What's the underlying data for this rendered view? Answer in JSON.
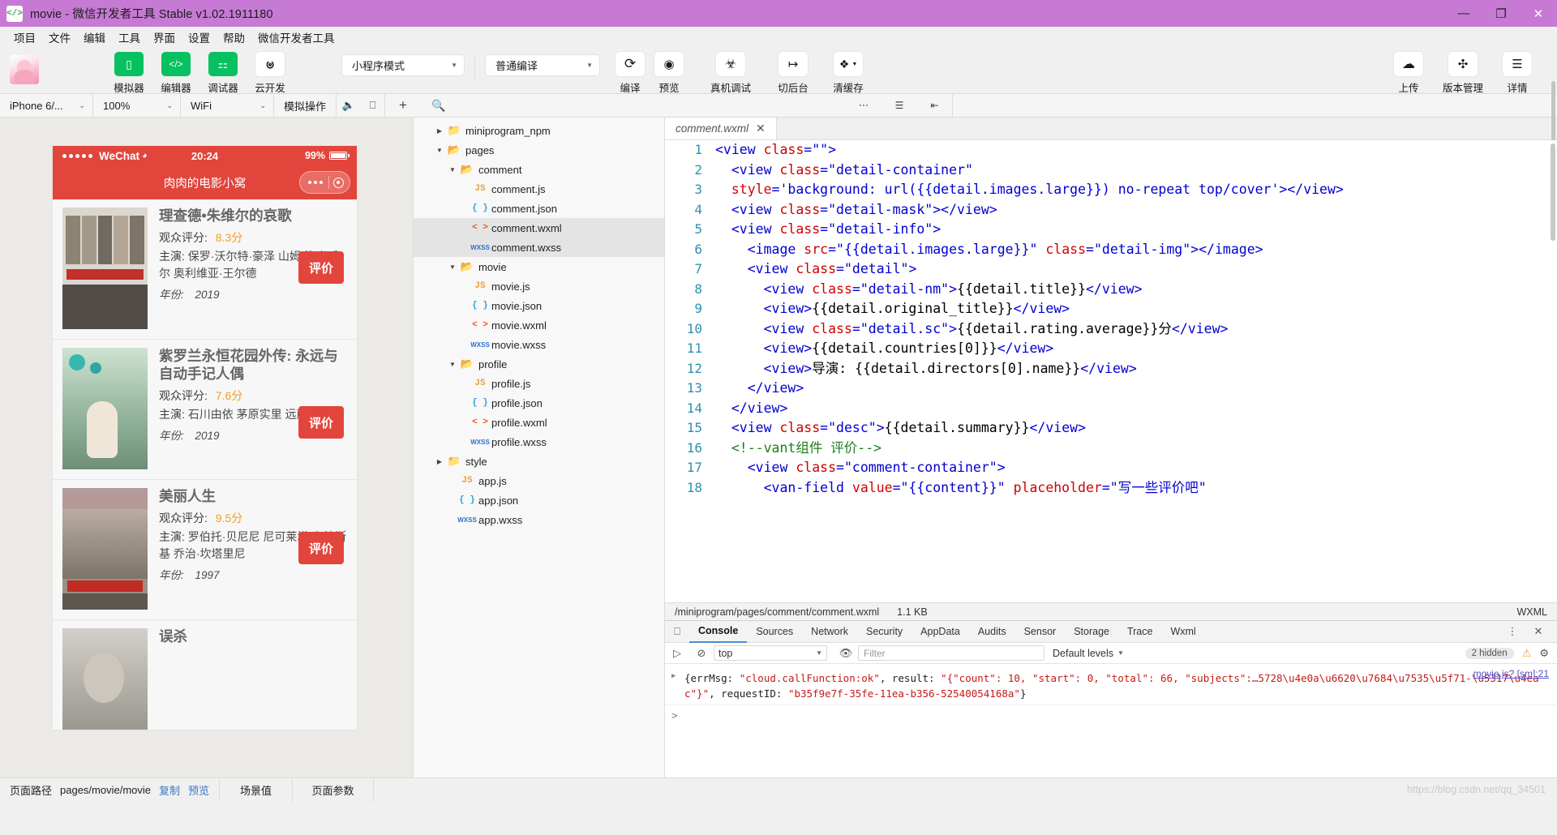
{
  "titlebar": {
    "title": "movie - 微信开发者工具 Stable v1.02.1911180",
    "logo": "</>",
    "minimize": "—",
    "maximize": "❐",
    "close": "✕"
  },
  "menubar": {
    "items": [
      "项目",
      "文件",
      "编辑",
      "工具",
      "界面",
      "设置",
      "帮助",
      "微信开发者工具"
    ]
  },
  "toolbar": {
    "left_tools": [
      {
        "label": "模拟器",
        "icon": "phone-icon",
        "glyph": "▯",
        "style": "green"
      },
      {
        "label": "编辑器",
        "icon": "code-icon",
        "glyph": "</>",
        "style": "green"
      },
      {
        "label": "调试器",
        "icon": "sliders-icon",
        "glyph": "⚏",
        "style": "green"
      },
      {
        "label": "云开发",
        "icon": "cloud-dev-icon",
        "glyph": "ᛩ",
        "style": "white"
      }
    ],
    "mode_select": "小程序模式",
    "compile_select": "普通编译",
    "actions": [
      {
        "label": "编译",
        "icon": "refresh-icon",
        "glyph": "⟳"
      },
      {
        "label": "预览",
        "icon": "eye-icon",
        "glyph": "◉"
      },
      {
        "label": "真机调试",
        "icon": "bug-icon",
        "glyph": "🐞"
      },
      {
        "label": "切后台",
        "icon": "background-icon",
        "glyph": "↦"
      },
      {
        "label": "清缓存",
        "icon": "layers-icon",
        "glyph": "≋"
      }
    ],
    "right_actions": [
      {
        "label": "上传",
        "icon": "upload-cloud-icon",
        "glyph": "☁"
      },
      {
        "label": "版本管理",
        "icon": "branch-icon",
        "glyph": "ᛤ"
      },
      {
        "label": "详情",
        "icon": "menu-icon",
        "glyph": "☰"
      }
    ]
  },
  "devicebar": {
    "device": "iPhone 6/...",
    "zoom": "100%",
    "network": "WiFi",
    "simulate": "模拟操作",
    "icons": [
      "volume-icon",
      "window-icon"
    ]
  },
  "simulator": {
    "status": {
      "carrier": "WeChat",
      "time": "20:24",
      "battery": "99%"
    },
    "nav_title": "肉肉的电影小窝",
    "labels": {
      "rating": "观众评分:",
      "actors": "主演:",
      "year": "年份:",
      "button": "评价"
    },
    "movies": [
      {
        "title": "理查德•朱维尔的哀歌",
        "rating": "8.3分",
        "actors": "保罗·沃尔特·豪泽 山姆·洛克威尔 奥利维亚·王尔德",
        "year": "2019",
        "poster": "p1"
      },
      {
        "title": "紫罗兰永恒花园外传: 永远与自动手记人偶",
        "rating": "7.6分",
        "actors": "石川由依 茅原实里 远藤绫",
        "year": "2019",
        "poster": "p2"
      },
      {
        "title": "美丽人生",
        "rating": "9.5分",
        "actors": "罗伯托·贝尼尼 尼可莱塔·布拉斯基 乔治·坎塔里尼",
        "year": "1997",
        "poster": "p3"
      },
      {
        "title": "误杀",
        "rating": "",
        "actors": "",
        "year": "",
        "poster": "p4"
      }
    ]
  },
  "explorer": {
    "toolbar_icons": [
      "add-icon",
      "search-icon",
      "more-icon",
      "collapse-icon",
      "sidebar-toggle-icon"
    ],
    "tree": [
      {
        "label": "miniprogram_npm",
        "type": "folder",
        "depth": 1,
        "expanded": false,
        "selected": false
      },
      {
        "label": "pages",
        "type": "folder",
        "depth": 1,
        "expanded": true,
        "selected": false
      },
      {
        "label": "comment",
        "type": "folder",
        "depth": 2,
        "expanded": true,
        "selected": false
      },
      {
        "label": "comment.js",
        "type": "js",
        "depth": 3,
        "selected": false
      },
      {
        "label": "comment.json",
        "type": "json",
        "depth": 3,
        "selected": false
      },
      {
        "label": "comment.wxml",
        "type": "wxml",
        "depth": 3,
        "selected": true
      },
      {
        "label": "comment.wxss",
        "type": "wxss",
        "depth": 3,
        "selected": true
      },
      {
        "label": "movie",
        "type": "folder",
        "depth": 2,
        "expanded": true,
        "selected": false
      },
      {
        "label": "movie.js",
        "type": "js",
        "depth": 3,
        "selected": false
      },
      {
        "label": "movie.json",
        "type": "json",
        "depth": 3,
        "selected": false
      },
      {
        "label": "movie.wxml",
        "type": "wxml",
        "depth": 3,
        "selected": false
      },
      {
        "label": "movie.wxss",
        "type": "wxss",
        "depth": 3,
        "selected": false
      },
      {
        "label": "profile",
        "type": "folder",
        "depth": 2,
        "expanded": true,
        "selected": false
      },
      {
        "label": "profile.js",
        "type": "js",
        "depth": 3,
        "selected": false
      },
      {
        "label": "profile.json",
        "type": "json",
        "depth": 3,
        "selected": false
      },
      {
        "label": "profile.wxml",
        "type": "wxml",
        "depth": 3,
        "selected": false
      },
      {
        "label": "profile.wxss",
        "type": "wxss",
        "depth": 3,
        "selected": false
      },
      {
        "label": "style",
        "type": "folder",
        "depth": 1,
        "expanded": false,
        "selected": false
      },
      {
        "label": "app.js",
        "type": "js",
        "depth": 2,
        "selected": false
      },
      {
        "label": "app.json",
        "type": "json",
        "depth": 2,
        "selected": false
      },
      {
        "label": "app.wxss",
        "type": "wxss",
        "depth": 2,
        "selected": false
      }
    ]
  },
  "editor": {
    "tab": {
      "name": "comment.wxml",
      "close": "✕"
    },
    "lines": [
      {
        "n": "1",
        "tokens": [
          {
            "t": "tg",
            "v": "<view "
          },
          {
            "t": "at",
            "v": "class"
          },
          {
            "t": "tg",
            "v": "="
          },
          {
            "t": "vl",
            "v": "\"\""
          },
          {
            "t": "tg",
            "v": ">"
          }
        ]
      },
      {
        "n": "2",
        "tokens": [
          {
            "t": "pl",
            "v": "  "
          },
          {
            "t": "tg",
            "v": "<view "
          },
          {
            "t": "at",
            "v": "class"
          },
          {
            "t": "tg",
            "v": "="
          },
          {
            "t": "vl",
            "v": "\"detail-container\""
          }
        ]
      },
      {
        "n": "3",
        "tokens": [
          {
            "t": "pl",
            "v": "  "
          },
          {
            "t": "at",
            "v": "style"
          },
          {
            "t": "tg",
            "v": "="
          },
          {
            "t": "vl",
            "v": "'background: url({{detail.images.large}}) no-repeat top/cover'"
          },
          {
            "t": "tg",
            "v": "></view>"
          }
        ]
      },
      {
        "n": "4",
        "tokens": [
          {
            "t": "pl",
            "v": "  "
          },
          {
            "t": "tg",
            "v": "<view "
          },
          {
            "t": "at",
            "v": "class"
          },
          {
            "t": "tg",
            "v": "="
          },
          {
            "t": "vl",
            "v": "\"detail-mask\""
          },
          {
            "t": "tg",
            "v": "></view>"
          }
        ]
      },
      {
        "n": "5",
        "tokens": [
          {
            "t": "pl",
            "v": "  "
          },
          {
            "t": "tg",
            "v": "<view "
          },
          {
            "t": "at",
            "v": "class"
          },
          {
            "t": "tg",
            "v": "="
          },
          {
            "t": "vl",
            "v": "\"detail-info\""
          },
          {
            "t": "tg",
            "v": ">"
          }
        ]
      },
      {
        "n": "6",
        "tokens": [
          {
            "t": "pl",
            "v": "    "
          },
          {
            "t": "tg",
            "v": "<image "
          },
          {
            "t": "at",
            "v": "src"
          },
          {
            "t": "tg",
            "v": "="
          },
          {
            "t": "vl",
            "v": "\"{{detail.images.large}}\""
          },
          {
            "t": "pl",
            "v": " "
          },
          {
            "t": "at",
            "v": "class"
          },
          {
            "t": "tg",
            "v": "="
          },
          {
            "t": "vl",
            "v": "\"detail-img\""
          },
          {
            "t": "tg",
            "v": "></image>"
          }
        ]
      },
      {
        "n": "7",
        "tokens": [
          {
            "t": "pl",
            "v": "    "
          },
          {
            "t": "tg",
            "v": "<view "
          },
          {
            "t": "at",
            "v": "class"
          },
          {
            "t": "tg",
            "v": "="
          },
          {
            "t": "vl",
            "v": "\"detail\""
          },
          {
            "t": "tg",
            "v": ">"
          }
        ]
      },
      {
        "n": "8",
        "tokens": [
          {
            "t": "pl",
            "v": "      "
          },
          {
            "t": "tg",
            "v": "<view "
          },
          {
            "t": "at",
            "v": "class"
          },
          {
            "t": "tg",
            "v": "="
          },
          {
            "t": "vl",
            "v": "\"detail-nm\""
          },
          {
            "t": "tg",
            "v": ">"
          },
          {
            "t": "pl",
            "v": "{{detail.title}}"
          },
          {
            "t": "tg",
            "v": "</view>"
          }
        ]
      },
      {
        "n": "9",
        "tokens": [
          {
            "t": "pl",
            "v": "      "
          },
          {
            "t": "tg",
            "v": "<view>"
          },
          {
            "t": "pl",
            "v": "{{detail.original_title}}"
          },
          {
            "t": "tg",
            "v": "</view>"
          }
        ]
      },
      {
        "n": "10",
        "tokens": [
          {
            "t": "pl",
            "v": "      "
          },
          {
            "t": "tg",
            "v": "<view "
          },
          {
            "t": "at",
            "v": "class"
          },
          {
            "t": "tg",
            "v": "="
          },
          {
            "t": "vl",
            "v": "\"detail.sc\""
          },
          {
            "t": "tg",
            "v": ">"
          },
          {
            "t": "pl",
            "v": "{{detail.rating.average}}分"
          },
          {
            "t": "tg",
            "v": "</view>"
          }
        ]
      },
      {
        "n": "11",
        "tokens": [
          {
            "t": "pl",
            "v": "      "
          },
          {
            "t": "tg",
            "v": "<view>"
          },
          {
            "t": "pl",
            "v": "{{detail.countries[0]}}"
          },
          {
            "t": "tg",
            "v": "</view>"
          }
        ]
      },
      {
        "n": "12",
        "tokens": [
          {
            "t": "pl",
            "v": "      "
          },
          {
            "t": "tg",
            "v": "<view>"
          },
          {
            "t": "pl",
            "v": "导演: {{detail.directors[0].name}}"
          },
          {
            "t": "tg",
            "v": "</view>"
          }
        ]
      },
      {
        "n": "13",
        "tokens": [
          {
            "t": "pl",
            "v": "    "
          },
          {
            "t": "tg",
            "v": "</view>"
          }
        ]
      },
      {
        "n": "14",
        "tokens": [
          {
            "t": "pl",
            "v": "  "
          },
          {
            "t": "tg",
            "v": "</view>"
          }
        ]
      },
      {
        "n": "15",
        "tokens": [
          {
            "t": "pl",
            "v": "  "
          },
          {
            "t": "tg",
            "v": "<view "
          },
          {
            "t": "at",
            "v": "class"
          },
          {
            "t": "tg",
            "v": "="
          },
          {
            "t": "vl",
            "v": "\"desc\""
          },
          {
            "t": "tg",
            "v": ">"
          },
          {
            "t": "pl",
            "v": "{{detail.summary}}"
          },
          {
            "t": "tg",
            "v": "</view>"
          }
        ]
      },
      {
        "n": "16",
        "tokens": [
          {
            "t": "pl",
            "v": "  "
          },
          {
            "t": "cm",
            "v": "<!--vant组件 评价-->"
          }
        ]
      },
      {
        "n": "17",
        "tokens": [
          {
            "t": "pl",
            "v": "    "
          },
          {
            "t": "tg",
            "v": "<view "
          },
          {
            "t": "at",
            "v": "class"
          },
          {
            "t": "tg",
            "v": "="
          },
          {
            "t": "vl",
            "v": "\"comment-container\""
          },
          {
            "t": "tg",
            "v": ">"
          }
        ]
      },
      {
        "n": "18",
        "tokens": [
          {
            "t": "pl",
            "v": "      "
          },
          {
            "t": "tg",
            "v": "<van-field "
          },
          {
            "t": "at",
            "v": "value"
          },
          {
            "t": "tg",
            "v": "="
          },
          {
            "t": "vl",
            "v": "\"{{content}}\""
          },
          {
            "t": "pl",
            "v": " "
          },
          {
            "t": "at",
            "v": "placeholder"
          },
          {
            "t": "tg",
            "v": "="
          },
          {
            "t": "vl",
            "v": "\"写一些评价吧\""
          }
        ]
      }
    ],
    "statusline": {
      "path": "/miniprogram/pages/comment/comment.wxml",
      "size": "1.1 KB",
      "lang": "WXML"
    }
  },
  "devtools": {
    "tabs": [
      "Console",
      "Sources",
      "Network",
      "Security",
      "AppData",
      "Audits",
      "Sensor",
      "Storage",
      "Trace",
      "Wxml"
    ],
    "active_tab": "Console",
    "context": "top",
    "filter_placeholder": "Filter",
    "levels": "Default levels",
    "hidden_count": "2 hidden",
    "console_rows": [
      {
        "source": "movie.js? [sm]:21",
        "segments": [
          {
            "t": "plain",
            "v": "{errMsg: "
          },
          {
            "t": "str",
            "v": "\"cloud.callFunction:ok\""
          },
          {
            "t": "plain",
            "v": ", result: "
          },
          {
            "t": "str",
            "v": "\"{\"count\": 10, \"start\": 0, \"total\": 66, \"subjects\":…5728\\u4e0a\\u6620\\u7684\\u7535\\u5f71-\\u5317\\u4eac\"}\""
          },
          {
            "t": "plain",
            "v": ", requestID: "
          },
          {
            "t": "str",
            "v": "\"b35f9e7f-35fe-11ea-b356-52540054168a\""
          },
          {
            "t": "plain",
            "v": "}"
          }
        ]
      }
    ],
    "prompt": ">",
    "icons": [
      "inspect-icon",
      "clear-console-icon",
      "eye-icon",
      "settings-icon",
      "kebab-icon"
    ]
  },
  "bottombar": {
    "path_label": "页面路径",
    "path_value": "pages/movie/movie",
    "copy": "复制",
    "preview": "预览",
    "scene": "场景值",
    "params": "页面参数",
    "watermark": "https://blog.csdn.net/qq_34501"
  }
}
